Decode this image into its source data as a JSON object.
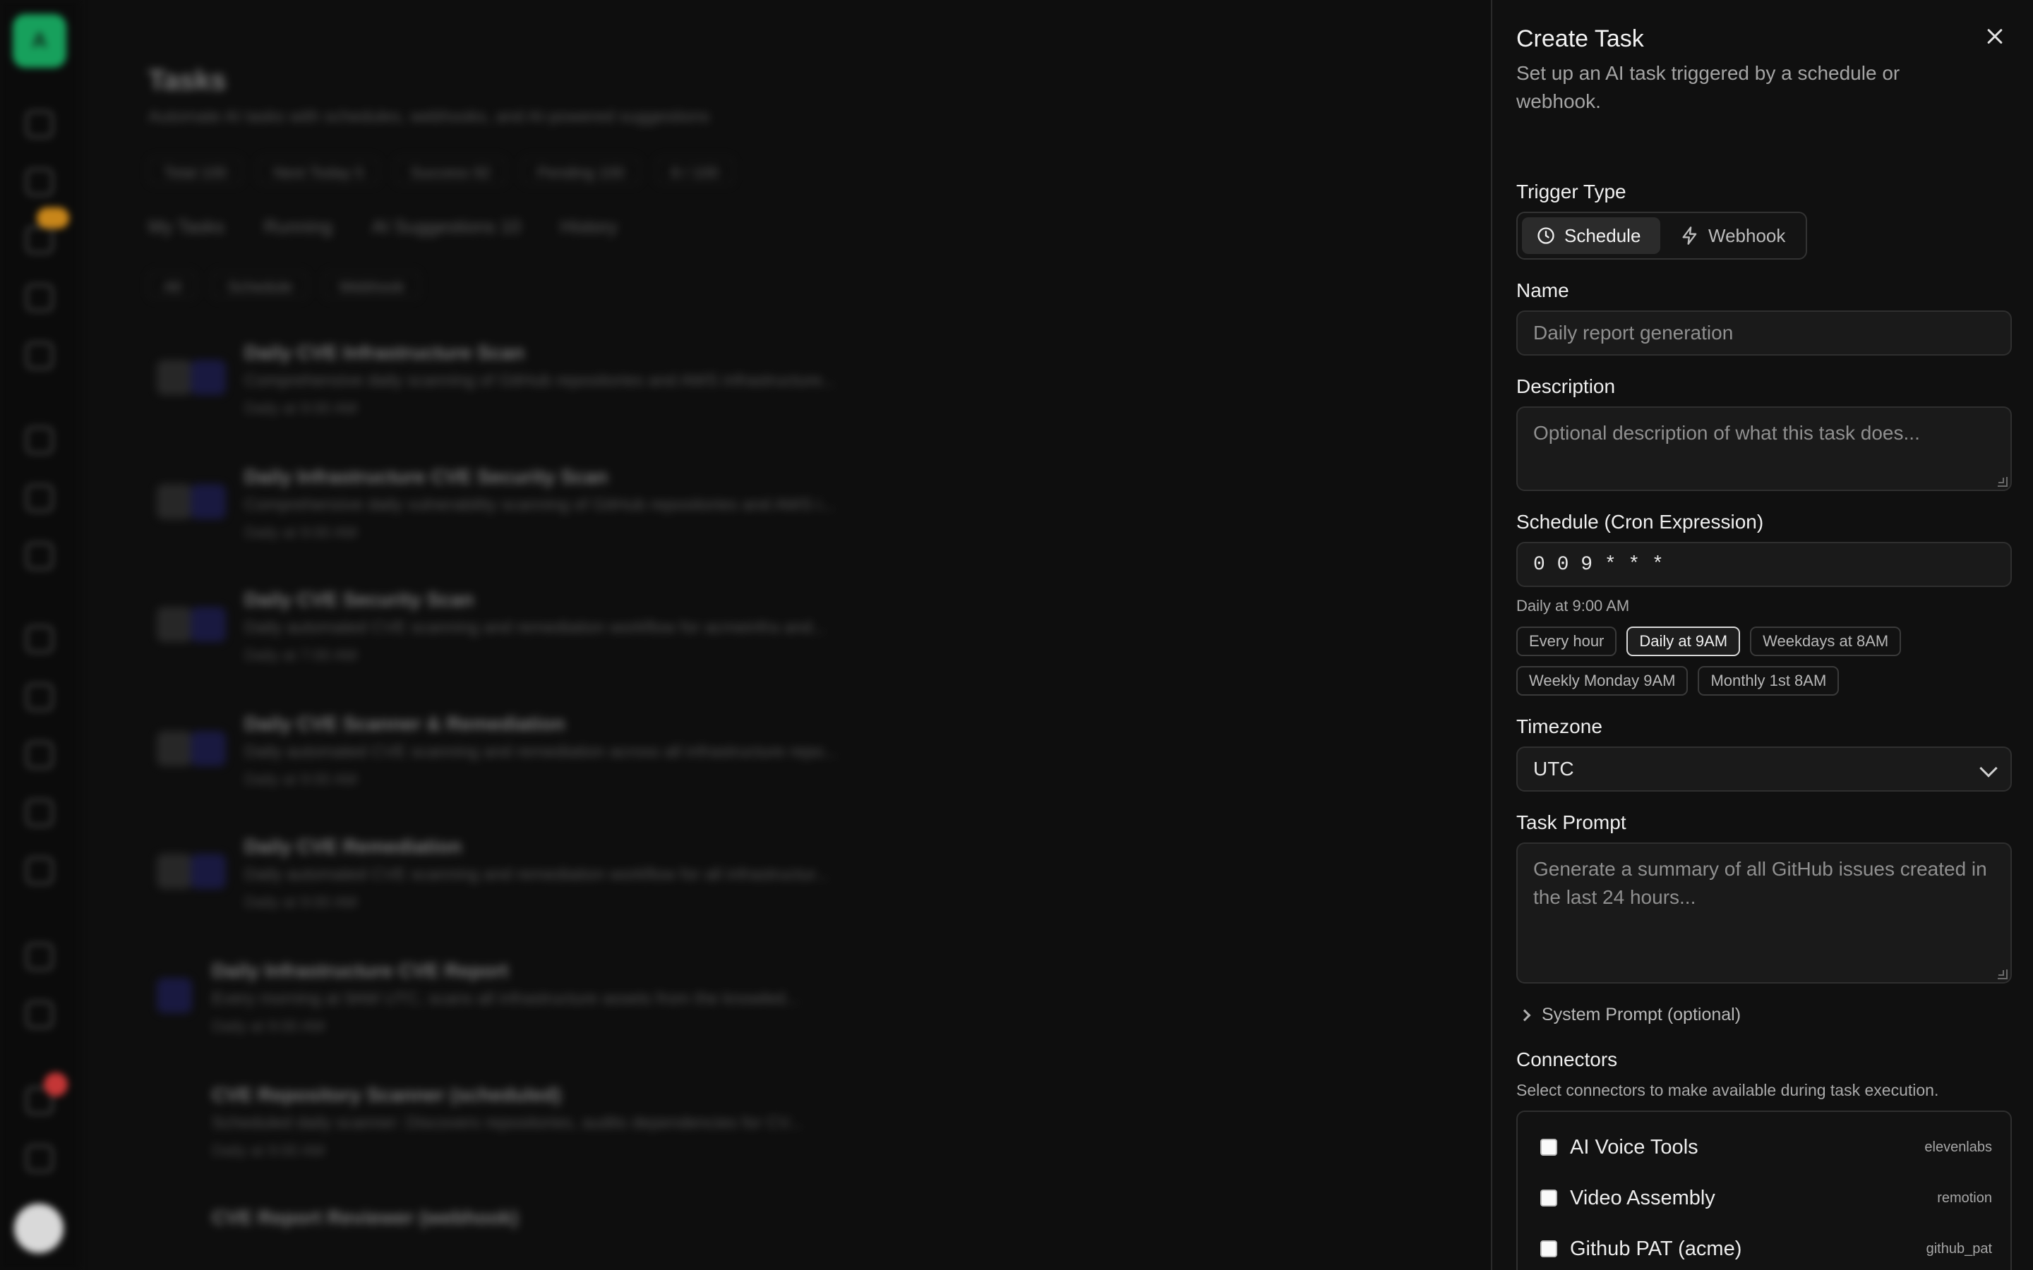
{
  "background": {
    "title": "Tasks",
    "subtitle": "Automate AI tasks with schedules, webhooks, and AI-powered suggestions",
    "stats": [
      "Total 100",
      "Next Today 5",
      "Success 92",
      "Pending 100",
      "8 / 100"
    ],
    "tabs": [
      "My Tasks",
      "Running",
      "AI Suggestions 10",
      "History"
    ],
    "filters": [
      "All",
      "Schedule",
      "Webhook"
    ],
    "rows": [
      {
        "title": "Daily CVE Infrastructure Scan",
        "desc": "Comprehensive daily scanning of GitHub repositories and AWS infrastructure...",
        "meta": "Daily at 9:00 AM"
      },
      {
        "title": "Daily Infrastructure CVE Security Scan",
        "desc": "Comprehensive daily vulnerability scanning of GitHub repositories and AWS i...",
        "meta": "Daily at 9:00 AM"
      },
      {
        "title": "Daily CVE Security Scan",
        "desc": "Daily automated CVE scanning and remediation workflow for acmeinfra and...",
        "meta": "Daily at 7:00 AM"
      },
      {
        "title": "Daily CVE Scanner & Remediation",
        "desc": "Daily automated CVE scanning and remediation across all infrastructure repo...",
        "meta": "Daily at 9:00 AM"
      },
      {
        "title": "Daily CVE Remediation",
        "desc": "Daily automated CVE scanning and remediation workflow for all infrastructur...",
        "meta": "Daily at 9:00 AM"
      },
      {
        "title": "Daily Infrastructure CVE Report",
        "desc": "Every morning at 9AM UTC, scans all infrastructure assets from the knowled...",
        "meta": "Daily at 9:00 AM"
      },
      {
        "title": "CVE Repository Scanner (scheduled)",
        "desc": "Scheduled daily scanner: Discovers repositories, audits dependencies for CV...",
        "meta": "Daily at 9:00 AM"
      },
      {
        "title": "CVE Report Reviewer (webhook)",
        "desc": "",
        "meta": ""
      }
    ]
  },
  "drawer": {
    "title": "Create Task",
    "subtitle": "Set up an AI task triggered by a schedule or webhook.",
    "trigger_label": "Trigger Type",
    "trigger_options": [
      "Schedule",
      "Webhook"
    ],
    "trigger_selected": "Schedule",
    "name_label": "Name",
    "name_placeholder": "Daily report generation",
    "description_label": "Description",
    "description_placeholder": "Optional description of what this task does...",
    "schedule_label": "Schedule (Cron Expression)",
    "cron_value": "0 0 9 * * *",
    "cron_hint": "Daily at 9:00 AM",
    "presets": [
      "Every hour",
      "Daily at 9AM",
      "Weekdays at 8AM",
      "Weekly Monday 9AM",
      "Monthly 1st 8AM"
    ],
    "preset_selected": "Daily at 9AM",
    "timezone_label": "Timezone",
    "timezone_value": "UTC",
    "prompt_label": "Task Prompt",
    "prompt_placeholder": "Generate a summary of all GitHub issues created in the last 24 hours...",
    "system_prompt_label": "System Prompt (optional)",
    "connectors_label": "Connectors",
    "connectors_hint": "Select connectors to make available during task execution.",
    "connectors": [
      {
        "name": "AI Voice Tools",
        "key": "elevenlabs"
      },
      {
        "name": "Video Assembly",
        "key": "remotion"
      },
      {
        "name": "Github PAT (acme)",
        "key": "github_pat"
      }
    ]
  },
  "colors": {
    "accent": "#17a05c",
    "panel": "#101010",
    "field": "#1a1a1a",
    "badge": "#c8861a"
  }
}
